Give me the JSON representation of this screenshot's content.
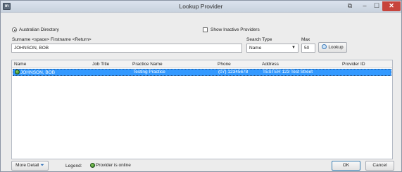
{
  "window": {
    "title": "Lookup Provider",
    "app_icon_text": "m",
    "controls": {
      "help": "⧉",
      "minimize": "–",
      "maximize": "☐",
      "close": "✕"
    }
  },
  "search": {
    "directory_option": "Australian Directory",
    "show_inactive_label": "Show Inactive Providers",
    "show_inactive_checked": false,
    "name_hint": "Surname <space> Firstname <Return>",
    "name_value": "JOHNSON, BOB",
    "search_type_label": "Search Type",
    "search_type_value": "Name",
    "max_label": "Max",
    "max_value": "50",
    "lookup_label": "Lookup"
  },
  "grid": {
    "columns": {
      "name": "Name",
      "job_title": "Job Title",
      "practice_name": "Practice Name",
      "phone": "Phone",
      "address": "Address",
      "provider_id": "Provider ID"
    },
    "rows": [
      {
        "name": "JOHNSON, BOB",
        "job_title": "",
        "practice_name": "Testing Practice",
        "phone": "(07) 12345678",
        "address": "TESTER 123 Test Street",
        "provider_id": "",
        "online": true,
        "selected": true
      }
    ]
  },
  "footer": {
    "more_detail_label": "More Detail",
    "legend_label": "Legend:",
    "legend_online_text": "Provider is online",
    "ok_label": "OK",
    "cancel_label": "Cancel"
  },
  "colors": {
    "selection": "#3399ff",
    "online_icon": "#3a8f2c",
    "close_button": "#c7443c"
  }
}
